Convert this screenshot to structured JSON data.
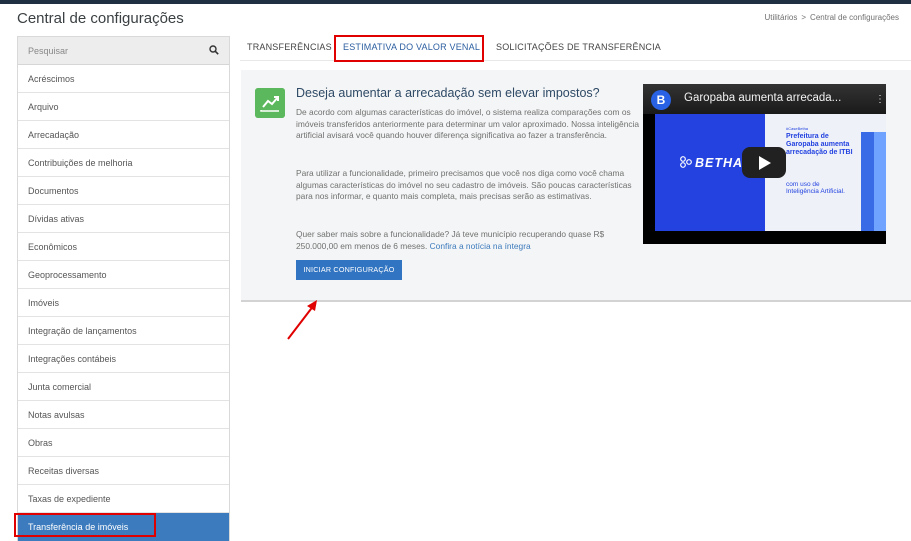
{
  "header": {
    "title": "Central de configurações",
    "breadcrumb": [
      "Utilitários",
      "Central de configurações"
    ],
    "breadcrumb_sep": ">"
  },
  "sidebar": {
    "search_placeholder": "Pesquisar",
    "items": [
      {
        "label": "Acréscimos"
      },
      {
        "label": "Arquivo"
      },
      {
        "label": "Arrecadação"
      },
      {
        "label": "Contribuições de melhoria"
      },
      {
        "label": "Documentos"
      },
      {
        "label": "Dívidas ativas"
      },
      {
        "label": "Econômicos"
      },
      {
        "label": "Geoprocessamento"
      },
      {
        "label": "Imóveis"
      },
      {
        "label": "Integração de lançamentos"
      },
      {
        "label": "Integrações contábeis"
      },
      {
        "label": "Junta comercial"
      },
      {
        "label": "Notas avulsas"
      },
      {
        "label": "Obras"
      },
      {
        "label": "Receitas diversas"
      },
      {
        "label": "Taxas de expediente"
      },
      {
        "label": "Transferência de imóveis",
        "active": true
      }
    ]
  },
  "tabs": [
    {
      "label": "TRANSFERÊNCIAS"
    },
    {
      "label": "ESTIMATIVA DO VALOR VENAL",
      "active": true
    },
    {
      "label": "SOLICITAÇÕES DE TRANSFERÊNCIA"
    }
  ],
  "panel": {
    "icon": "chart-line-icon",
    "heading": "Deseja aumentar a arrecadação sem elevar impostos?",
    "paragraph1": "De acordo com algumas características do imóvel, o sistema realiza comparações com os imóveis transferidos anteriormente para determinar um valor aproximado. Nossa inteligência artificial avisará você quando houver diferença significativa ao fazer a transferência.",
    "paragraph2": "Para utilizar a funcionalidade, primeiro precisamos que você nos diga como você chama algumas características do imóvel no seu cadastro de imóveis. São poucas características para nos informar, e quanto mais completa, mais precisas serão as estimativas.",
    "paragraph3": "Quer saber mais sobre a funcionalidade? Já teve município recuperando quase R$ 250.000,00 em menos de 6 meses.",
    "link_text": "Confira a notícia na íntegra",
    "button_label": "INICIAR CONFIGURAÇÃO"
  },
  "video": {
    "channel_initial": "B",
    "title": "Garopaba aumenta arrecada...",
    "brand": "BETHA",
    "hashtag": "#CaseBetha",
    "headline": "Prefeitura de Garopaba aumenta arrecadação de ITBI",
    "subline": "com uso de Inteligência Artificial."
  },
  "colors": {
    "accent": "#3174c1",
    "sidebar_active": "#3c7bbd",
    "highlight": "#e00000",
    "icon_green": "#5cb85c"
  }
}
